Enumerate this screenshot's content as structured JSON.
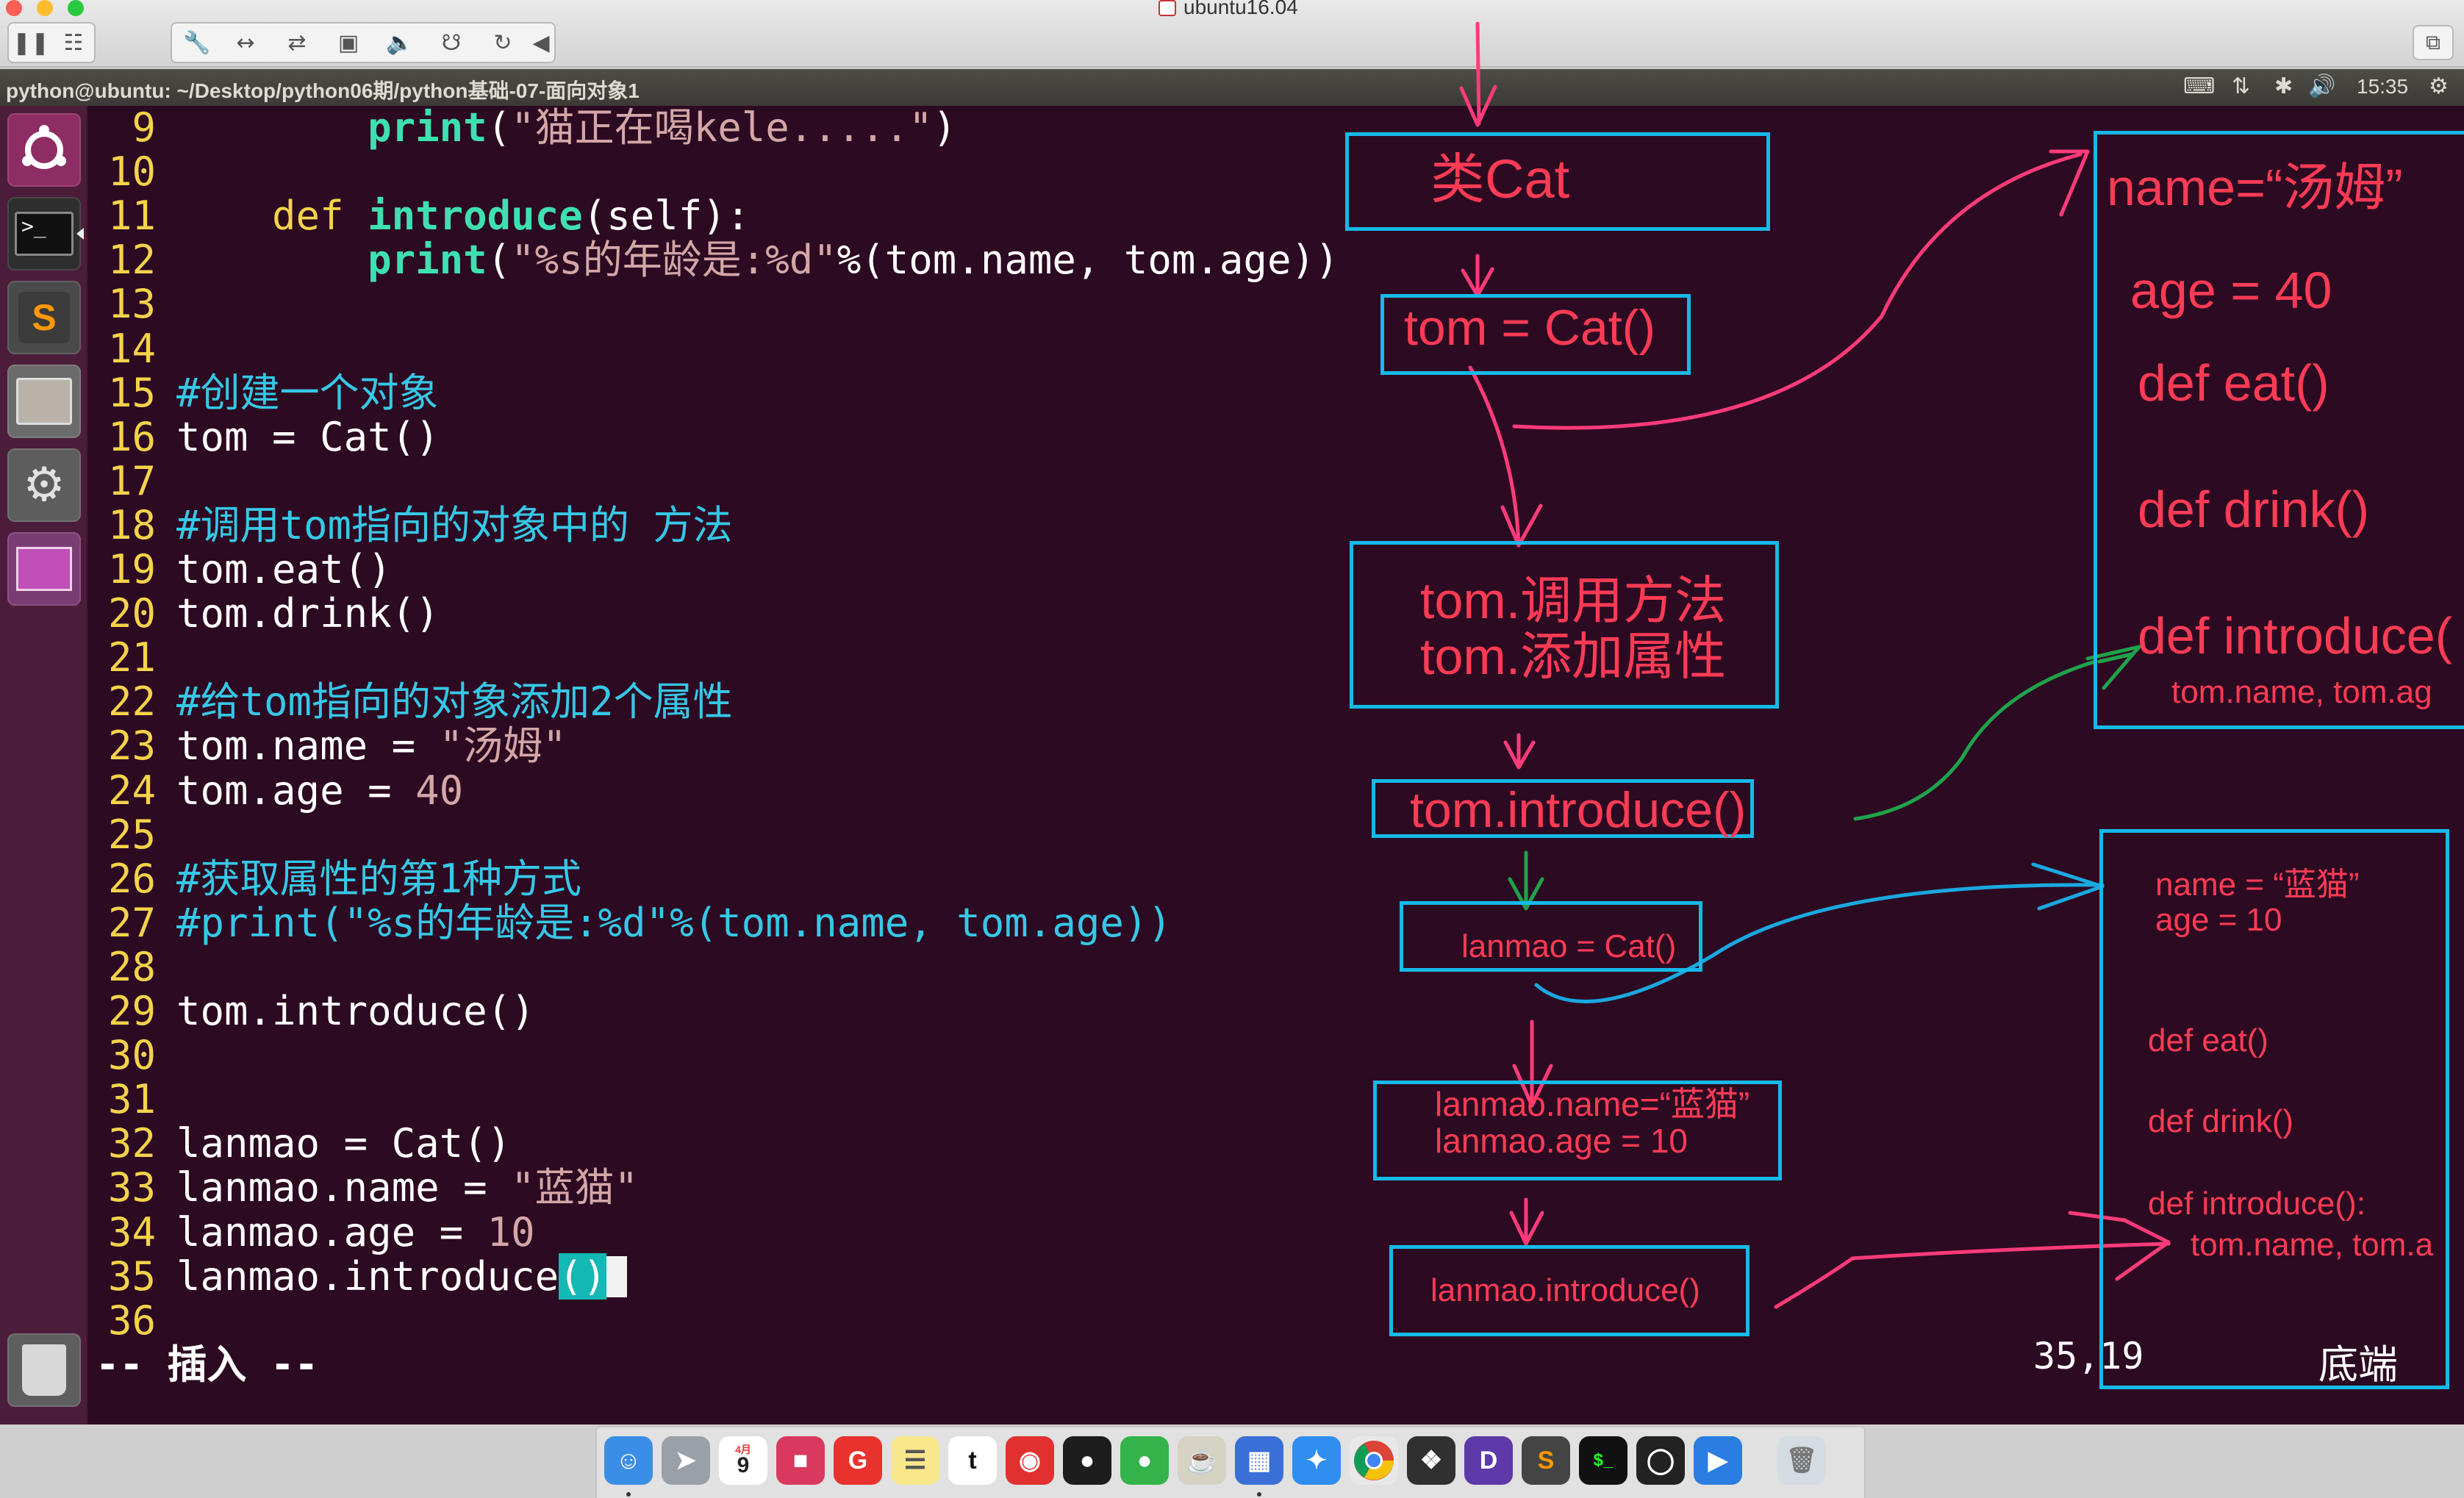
{
  "window": {
    "title": "ubuntu16.04"
  },
  "panel": {
    "title": "python@ubuntu: ~/Desktop/python06期/python基础-07-面向对象1",
    "time": "15:35"
  },
  "launcher": {
    "items": [
      "Ubuntu Dash",
      "Terminal",
      "Sublime Text",
      "Files",
      "System Settings",
      "Workspaces",
      "Trash"
    ]
  },
  "editor": {
    "lines": [
      {
        "n": "9",
        "segs": [
          {
            "t": "        "
          },
          {
            "t": "print",
            "c": "fn"
          },
          {
            "t": "("
          },
          {
            "t": "\"猫正在喝kele.....\"",
            "c": "str"
          },
          {
            "t": ")"
          }
        ]
      },
      {
        "n": "10",
        "segs": []
      },
      {
        "n": "11",
        "segs": [
          {
            "t": "    "
          },
          {
            "t": "def",
            "c": "kw"
          },
          {
            "t": " "
          },
          {
            "t": "introduce",
            "c": "fn"
          },
          {
            "t": "(self):"
          }
        ]
      },
      {
        "n": "12",
        "segs": [
          {
            "t": "        "
          },
          {
            "t": "print",
            "c": "fn"
          },
          {
            "t": "("
          },
          {
            "t": "\"%s的年龄是:%d\"",
            "c": "str"
          },
          {
            "t": "%(tom.name, tom.age))"
          }
        ]
      },
      {
        "n": "13",
        "segs": []
      },
      {
        "n": "14",
        "segs": []
      },
      {
        "n": "15",
        "segs": [
          {
            "t": "#创建一个对象",
            "c": "cm"
          }
        ]
      },
      {
        "n": "16",
        "segs": [
          {
            "t": "tom = Cat()"
          }
        ]
      },
      {
        "n": "17",
        "segs": []
      },
      {
        "n": "18",
        "segs": [
          {
            "t": "#调用tom指向的对象中的 方法",
            "c": "cm"
          }
        ]
      },
      {
        "n": "19",
        "segs": [
          {
            "t": "tom.eat()"
          }
        ]
      },
      {
        "n": "20",
        "segs": [
          {
            "t": "tom.drink()"
          }
        ]
      },
      {
        "n": "21",
        "segs": []
      },
      {
        "n": "22",
        "segs": [
          {
            "t": "#给tom指向的对象添加2个属性",
            "c": "cm"
          }
        ]
      },
      {
        "n": "23",
        "segs": [
          {
            "t": "tom.name = "
          },
          {
            "t": "\"汤姆\"",
            "c": "str"
          }
        ]
      },
      {
        "n": "24",
        "segs": [
          {
            "t": "tom.age = "
          },
          {
            "t": "40",
            "c": "num"
          }
        ]
      },
      {
        "n": "25",
        "segs": []
      },
      {
        "n": "26",
        "segs": [
          {
            "t": "#获取属性的第1种方式",
            "c": "cm"
          }
        ]
      },
      {
        "n": "27",
        "segs": [
          {
            "t": "#print(\"%s的年龄是:%d\"%(tom.name, tom.age))",
            "c": "cm"
          }
        ]
      },
      {
        "n": "28",
        "segs": []
      },
      {
        "n": "29",
        "segs": [
          {
            "t": "tom.introduce()"
          }
        ]
      },
      {
        "n": "30",
        "segs": []
      },
      {
        "n": "31",
        "segs": []
      },
      {
        "n": "32",
        "segs": [
          {
            "t": "lanmao = Cat()"
          }
        ]
      },
      {
        "n": "33",
        "segs": [
          {
            "t": "lanmao.name = "
          },
          {
            "t": "\"蓝猫\"",
            "c": "str"
          }
        ]
      },
      {
        "n": "34",
        "segs": [
          {
            "t": "lanmao.age = "
          },
          {
            "t": "10",
            "c": "num"
          }
        ]
      },
      {
        "n": "35",
        "segs": [
          {
            "t": "lanmao.introduce"
          },
          {
            "t": "()",
            "c": "cur-paren"
          },
          {
            "cursor": true
          }
        ]
      },
      {
        "n": "36",
        "segs": []
      }
    ],
    "mode": "-- 插入 --",
    "position": "35,19",
    "scroll": "底端"
  },
  "annotations": {
    "class_box": "类Cat",
    "tom_create": "tom = Cat()",
    "tom_ops": "tom.调用方法\ntom.添加属性",
    "tom_introduce": "tom.introduce()",
    "lanmao_create": "lanmao = Cat()",
    "lanmao_attrs": "lanmao.name=“蓝猫”\nlanmao.age = 10",
    "lanmao_introduce": "lanmao.introduce()",
    "tom_obj": {
      "name": "name=“汤姆”",
      "age": "age = 40",
      "eat": "def eat()",
      "drink": "def drink()",
      "introduce": "def introduce(",
      "args": "tom.name, tom.ag"
    },
    "lanmao_obj": {
      "attrs": "name = “蓝猫”\nage = 10",
      "eat": "def eat()",
      "drink": "def drink()",
      "introduce": "def introduce():",
      "args": "tom.name, tom.a"
    },
    "colors": {
      "box": "#16b9e8",
      "text": "#ff3b55",
      "arrow_green": "#1fa34a",
      "arrow_blue": "#1aa8df"
    }
  },
  "dock": {
    "items": [
      "Finder",
      "Launchpad",
      "Calendar",
      "Photo Booth",
      "G",
      "Notes",
      "t",
      "NetEase Music",
      "QQ",
      "WeChat",
      "Kettle",
      "VMware",
      "Safari",
      "Chrome",
      "Sketch",
      "D",
      "Sublime",
      "Terminal",
      "OBS",
      "QuickTime",
      "Trash"
    ],
    "calendar_day": "9",
    "calendar_month": "4月"
  }
}
